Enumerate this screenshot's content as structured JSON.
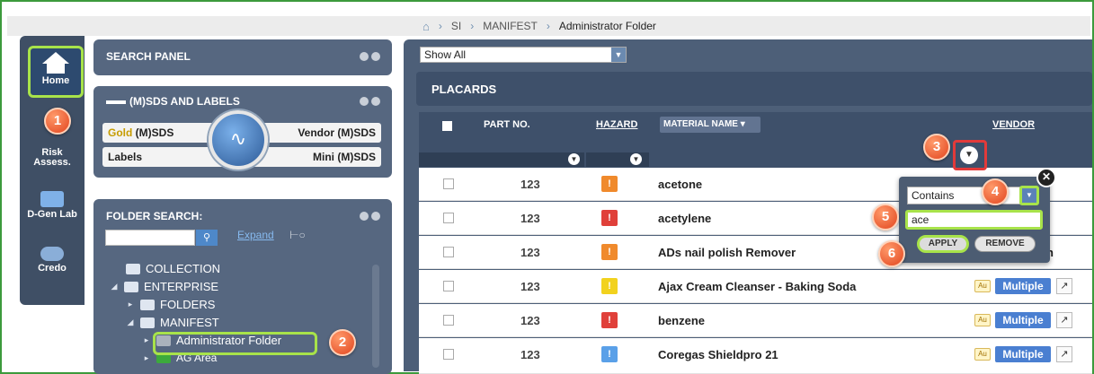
{
  "breadcrumb": {
    "items": [
      "SI",
      "MANIFEST",
      "Administrator Folder"
    ]
  },
  "nav": {
    "items": [
      {
        "label": "Home",
        "icon": "home-icon"
      },
      {
        "label": "Risk Assess.",
        "icon": "risk-icon"
      },
      {
        "label": "D-Gen Lab",
        "icon": "monitor-icon"
      },
      {
        "label": "Credo",
        "icon": "handshake-icon"
      }
    ]
  },
  "search_panel": {
    "title": "SEARCH PANEL"
  },
  "sds_panel": {
    "title": "(M)SDS AND LABELS",
    "gold_prefix": "Gold",
    "gold_suffix": " (M)SDS",
    "vendor": "Vendor (M)SDS",
    "labels": "Labels",
    "mini": "Mini (M)SDS"
  },
  "folder_search": {
    "title": "FOLDER SEARCH:",
    "expand": "Expand",
    "tree": [
      "COLLECTION",
      "ENTERPRISE",
      "FOLDERS",
      "MANIFEST",
      "Administrator Folder",
      "AG Area"
    ]
  },
  "main": {
    "show_all": "Show All",
    "placards_title": "PLACARDS",
    "columns": {
      "part_no": "PART NO.",
      "hazard": "HAZARD",
      "material_name": "MATERIAL NAME",
      "vendor": "VENDOR"
    },
    "part_icon_text": "123",
    "rows": [
      {
        "name": "acetone",
        "hazard_color": "#f08a2c",
        "au": "",
        "vendor": ""
      },
      {
        "name": "acetylene",
        "hazard_color": "#e0403a",
        "au": "",
        "vendor": ""
      },
      {
        "name": "ADs nail polish Remover",
        "hazard_color": "#f08a2c",
        "au": "",
        "vendor": "h"
      },
      {
        "name": "Ajax Cream Cleanser - Baking Soda",
        "hazard_color": "#f2d21e",
        "au": "Au",
        "vendor": "Multiple"
      },
      {
        "name": "benzene",
        "hazard_color": "#e0403a",
        "au": "Au",
        "vendor": "Multiple"
      },
      {
        "name": "Coregas Shieldpro 21",
        "hazard_color": "#5aa0e8",
        "au": "Au",
        "vendor": "Multiple"
      }
    ]
  },
  "filter_popover": {
    "condition": "Contains",
    "value": "ace",
    "apply": "APPLY",
    "remove": "REMOVE"
  },
  "badges": [
    "1",
    "2",
    "3",
    "4",
    "5",
    "6"
  ]
}
